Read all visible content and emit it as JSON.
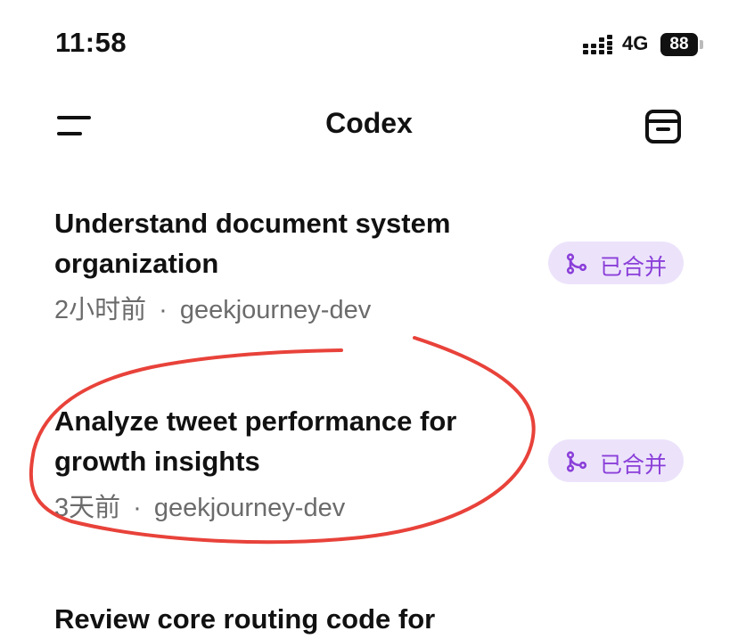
{
  "status_bar": {
    "time": "11:58",
    "network": "4G",
    "battery": "88"
  },
  "nav": {
    "title": "Codex"
  },
  "tasks": [
    {
      "title": "Understand document system organization",
      "time": "2小时前",
      "separator": "·",
      "repo": "geekjourney-dev",
      "status": "已合并"
    },
    {
      "title": "Analyze tweet performance for growth insights",
      "time": "3天前",
      "separator": "·",
      "repo": "geekjourney-dev",
      "status": "已合并"
    },
    {
      "title": "Review core routing code for"
    }
  ],
  "colors": {
    "badge_bg": "#ece3fb",
    "badge_text": "#8b3fd9",
    "annotation": "#e8423a"
  },
  "icons": [
    "signal-icon",
    "battery-icon",
    "menu-icon",
    "archive-icon",
    "merge-icon"
  ]
}
